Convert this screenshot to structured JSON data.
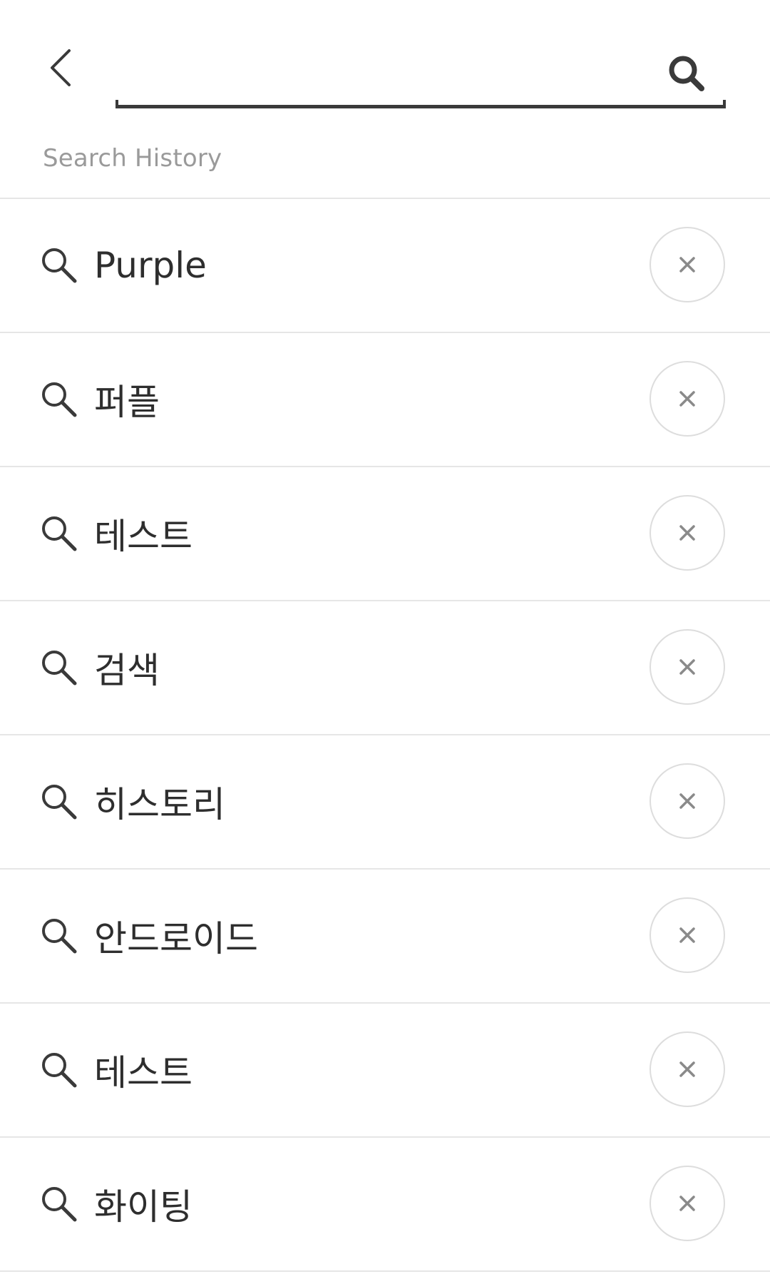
{
  "header": {
    "back_icon": "chevron-left-icon",
    "search_placeholder": "",
    "search_value": "",
    "search_icon": "search-icon"
  },
  "history": {
    "label": "Search History",
    "items": [
      {
        "text": "Purple"
      },
      {
        "text": "퍼플"
      },
      {
        "text": "테스트"
      },
      {
        "text": "검색"
      },
      {
        "text": "히스토리"
      },
      {
        "text": "안드로이드"
      },
      {
        "text": "테스트"
      },
      {
        "text": "화이팅"
      }
    ],
    "item_icon": "search-icon",
    "delete_icon": "close-icon"
  },
  "colors": {
    "text": "#2e2e2e",
    "label": "#9a9a9a",
    "divider": "#e6e6e6",
    "icon": "#3a3a3a"
  }
}
